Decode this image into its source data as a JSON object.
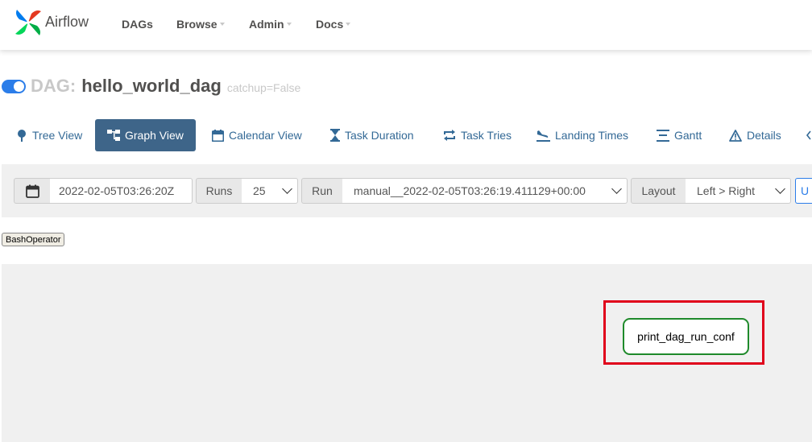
{
  "app": {
    "name": "Airflow"
  },
  "nav": {
    "items": [
      "DAGs",
      "Browse",
      "Admin",
      "Docs"
    ]
  },
  "dag": {
    "prefix": "DAG:",
    "name": "hello_world_dag",
    "subtitle": "catchup=False",
    "paused": false
  },
  "tabs": [
    {
      "label": "Tree View",
      "icon": "tree-icon",
      "active": false
    },
    {
      "label": "Graph View",
      "icon": "graph-icon",
      "active": true
    },
    {
      "label": "Calendar View",
      "icon": "calendar-icon",
      "active": false
    },
    {
      "label": "Task Duration",
      "icon": "hourglass-icon",
      "active": false
    },
    {
      "label": "Task Tries",
      "icon": "repeat-icon",
      "active": false
    },
    {
      "label": "Landing Times",
      "icon": "plane-landing-icon",
      "active": false
    },
    {
      "label": "Gantt",
      "icon": "gantt-icon",
      "active": false
    },
    {
      "label": "Details",
      "icon": "warning-triangle-icon",
      "active": false
    }
  ],
  "controls": {
    "base_date": "2022-02-05T03:26:20Z",
    "runs_label": "Runs",
    "runs_value": "25",
    "run_label": "Run",
    "run_value": "manual__2022-02-05T03:26:19.411129+00:00",
    "layout_label": "Layout",
    "layout_value": "Left > Right",
    "update_label": "U"
  },
  "legend": {
    "operator": "BashOperator"
  },
  "graph": {
    "task": "print_dag_run_conf"
  },
  "colors": {
    "accent": "#2b7de9",
    "active_tab": "#3e6589",
    "task_border": "#1f8a2b",
    "highlight": "#e0001b"
  }
}
